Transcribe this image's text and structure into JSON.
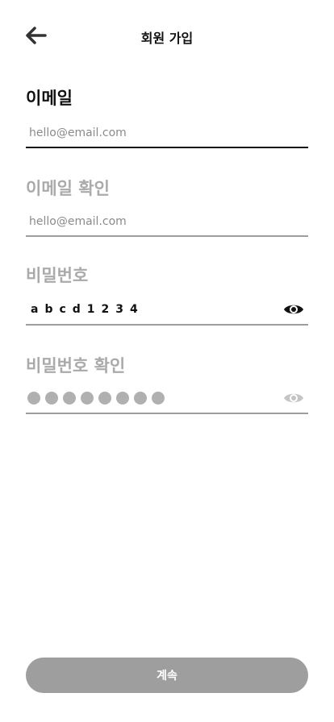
{
  "header": {
    "title": "회원 가입",
    "back_icon": "arrow-left-icon"
  },
  "email": {
    "label": "이메일",
    "placeholder": "hello@email.com",
    "value": ""
  },
  "email_confirm": {
    "label": "이메일 확인",
    "placeholder": "hello@email.com",
    "value": ""
  },
  "password": {
    "label": "비밀번호",
    "value_shown": "abcd1234",
    "toggle_icon": "eye-icon"
  },
  "password_confirm": {
    "label": "비밀번호 확인",
    "masked_count": 8,
    "toggle_icon": "eye-icon"
  },
  "continue_button": {
    "label": "계속"
  },
  "colors": {
    "text_active": "#111111",
    "text_inactive": "#aaaaaa",
    "button_bg": "#9e9e9e",
    "underline": "#9e9e9e"
  }
}
